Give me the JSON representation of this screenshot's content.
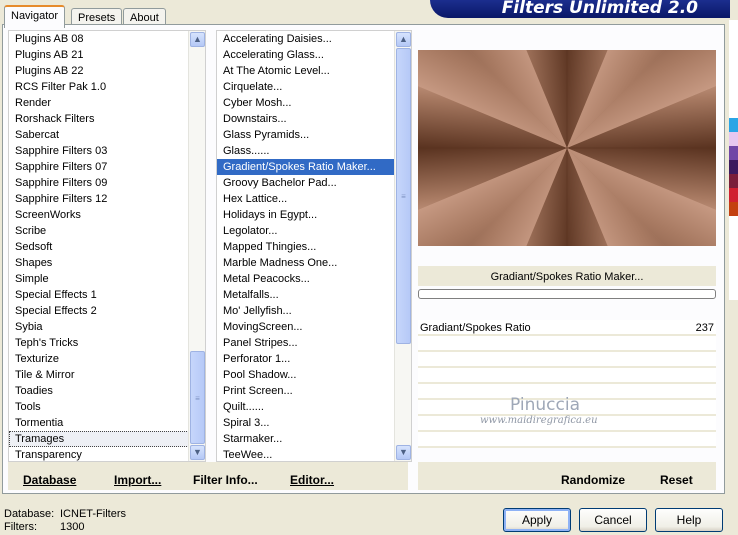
{
  "tabs": [
    "Navigator",
    "Presets",
    "About"
  ],
  "banner_title": "Filters Unlimited 2.0",
  "categories": {
    "items": [
      "Plugins AB 08",
      "Plugins AB 21",
      "Plugins AB 22",
      "RCS Filter Pak 1.0",
      "Render",
      "Rorshack Filters",
      "Sabercat",
      "Sapphire Filters 03",
      "Sapphire Filters 07",
      "Sapphire Filters 09",
      "Sapphire Filters 12",
      "ScreenWorks",
      "Scribe",
      "Sedsoft",
      "Shapes",
      "Simple",
      "Special Effects 1",
      "Special Effects 2",
      "Sybia",
      "Teph's Tricks",
      "Texturize",
      "Tile & Mirror",
      "Toadies",
      "Tools",
      "Tormentia",
      "Tramages",
      "Transparency"
    ],
    "current": "Tramages"
  },
  "filters": {
    "items": [
      "Accelerating Daisies...",
      "Accelerating Glass...",
      "At The Atomic Level...",
      "Cirquelate...",
      "Cyber Mosh...",
      "Downstairs...",
      "Glass Pyramids...",
      "Glass......",
      "Gradient/Spokes Ratio Maker...",
      "Groovy Bachelor Pad...",
      "Hex Lattice...",
      "Holidays in Egypt...",
      "Legolator...",
      "Mapped Thingies...",
      "Marble Madness One...",
      "Metal Peacocks...",
      "Metalfalls...",
      "Mo' Jellyfish...",
      "MovingScreen...",
      "Panel Stripes...",
      "Perforator 1...",
      "Pool Shadow...",
      "Print Screen...",
      "Quilt......",
      "Spiral 3...",
      "Starmaker...",
      "TeeWee..."
    ],
    "selected": "Gradient/Spokes Ratio Maker..."
  },
  "preview": {
    "filter_name": "Gradiant/Spokes Ratio Maker...",
    "parameter_label": "Gradiant/Spokes Ratio",
    "parameter_value": "237",
    "colors": {
      "dark": "#5a3320",
      "mid": "#a87a62",
      "light": "#f3c7b2"
    }
  },
  "watermark": {
    "name": "Pinuccia",
    "site": "www.maidiregrafica.eu"
  },
  "links": {
    "database": "Database",
    "import": "Import...",
    "filter_info": "Filter Info...",
    "editor": "Editor...",
    "randomize": "Randomize",
    "reset": "Reset"
  },
  "status": {
    "database_label": "Database:",
    "database_value": "ICNET-Filters",
    "filters_label": "Filters:",
    "filters_value": "1300"
  },
  "buttons": {
    "apply": "Apply",
    "cancel": "Cancel",
    "help": "Help"
  },
  "strip_colors": [
    "#ffffff",
    "#ffffff",
    "#ffffff",
    "#ffffff",
    "#ffffff",
    "#ffffff",
    "#ffffff",
    "#2aa5e6",
    "#e6c7f0",
    "#7046a6",
    "#3c1a5e",
    "#7a1e3a",
    "#d02030",
    "#c44010",
    "#ffffff",
    "#ffffff",
    "#ffffff",
    "#ffffff",
    "#ffffff",
    "#ffffff"
  ]
}
